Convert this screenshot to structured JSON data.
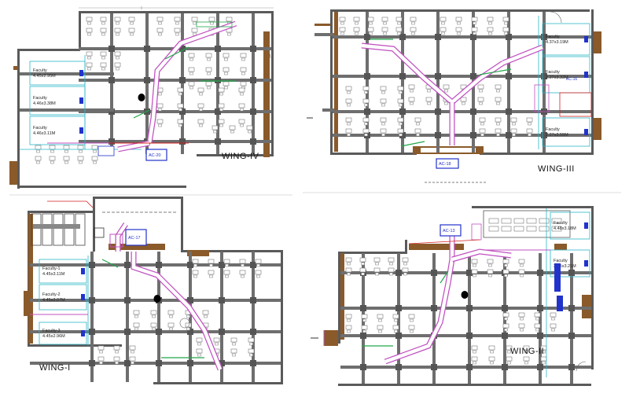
{
  "drawing": {
    "wings": [
      {
        "id": "wing-4",
        "title": "WING-IV",
        "rooms": [
          {
            "name": "Faculty",
            "area": "4.45x2.95M"
          },
          {
            "name": "Faculty",
            "area": "4.46x3.38M"
          },
          {
            "name": "Faculty",
            "area": "4.46x3.11M"
          }
        ],
        "ac_units": [
          "AC-20"
        ]
      },
      {
        "id": "wing-3",
        "title": "WING-III",
        "rooms": [
          {
            "name": "Faculty",
            "area": "4.37x3.19M"
          },
          {
            "name": "Faculty",
            "area": "2.27x3.32M"
          },
          {
            "name": "Faculty",
            "area": "2.27x3.55M"
          }
        ],
        "ac_units": [
          "AC-16",
          "AC-18"
        ]
      },
      {
        "id": "wing-1",
        "title": "WING-I",
        "rooms": [
          {
            "name": "Faculty-1",
            "area": "4.45x3.11M"
          },
          {
            "name": "Faculty-2",
            "area": "4.45x3.07M"
          },
          {
            "name": "Faculty-3",
            "area": "4.45x2.96M"
          }
        ],
        "ac_units": [
          "AC-17"
        ]
      },
      {
        "id": "wing-2",
        "title": "WING-II",
        "rooms": [
          {
            "name": "Faculty",
            "area": "4.48x3.18M"
          },
          {
            "name": "Faculty",
            "area": "2.45x3.21M"
          }
        ],
        "ac_units": [
          "AC-13"
        ]
      }
    ],
    "colors": {
      "wall": "#5a5a5a",
      "column": "#6e6e6e",
      "duct": "#c050c0",
      "annotation_green": "#22a84a",
      "cyan_line": "#2ab6c8",
      "brown": "#8a5a2a",
      "ac_blue": "#2233cc",
      "red": "#d42020",
      "furniture": "#777777"
    }
  }
}
